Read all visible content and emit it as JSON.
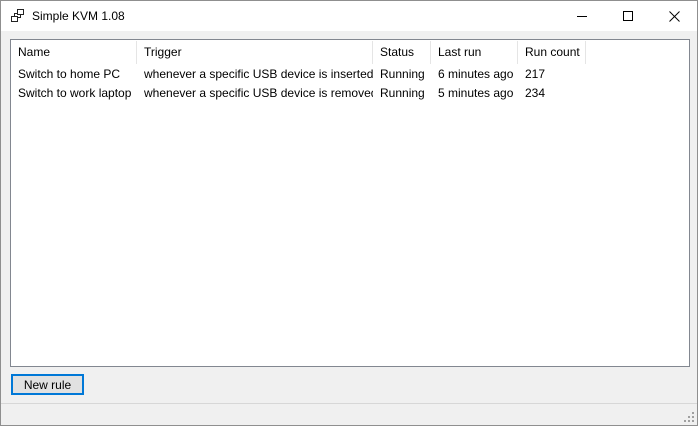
{
  "window": {
    "title": "Simple KVM 1.08",
    "icon": "kvm-switch-icon"
  },
  "caption_buttons": [
    "minimize-icon",
    "maximize-icon",
    "close-icon"
  ],
  "table": {
    "columns": [
      "Name",
      "Trigger",
      "Status",
      "Last run",
      "Run count"
    ],
    "rows": [
      {
        "name": "Switch to home PC",
        "trigger": "whenever a specific USB device is inserted",
        "status": "Running",
        "last_run": "6 minutes ago",
        "run_count": "217"
      },
      {
        "name": "Switch to work laptop",
        "trigger": "whenever a specific USB device is removed",
        "status": "Running",
        "last_run": "5 minutes ago",
        "run_count": "234"
      }
    ]
  },
  "actions": {
    "new_rule_label": "New rule"
  },
  "colors": {
    "accent": "#0078d7",
    "window_bg": "#f0f0f0",
    "list_bg": "#ffffff"
  }
}
